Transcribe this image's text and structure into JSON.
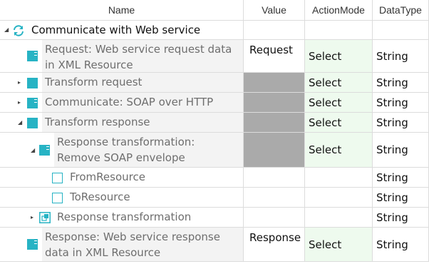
{
  "columns": {
    "name": "Name",
    "value": "Value",
    "action_mode": "ActionMode",
    "data_type": "DataType"
  },
  "root": {
    "label": "Communicate with Web service"
  },
  "rows": [
    {
      "name": "Request: Web service request data in XML Resource",
      "value": "Request",
      "action_mode": "Select",
      "data_type": "String"
    },
    {
      "name": "Transform request",
      "value": "",
      "action_mode": "Select",
      "data_type": "String"
    },
    {
      "name": "Communicate: SOAP over HTTP",
      "value": "",
      "action_mode": "Select",
      "data_type": "String"
    },
    {
      "name": "Transform response",
      "value": "",
      "action_mode": "Select",
      "data_type": "String"
    },
    {
      "name": "Response transformation: Remove SOAP envelope",
      "value": "",
      "action_mode": "Select",
      "data_type": "String"
    },
    {
      "name": "FromResource",
      "value": "",
      "action_mode": "",
      "data_type": "String"
    },
    {
      "name": "ToResource",
      "value": "",
      "action_mode": "",
      "data_type": "String"
    },
    {
      "name": "Response transformation",
      "value": "",
      "action_mode": "",
      "data_type": "String"
    },
    {
      "name": "Response: Web service response data in XML Resource",
      "value": "Response",
      "action_mode": "Select",
      "data_type": "String"
    }
  ],
  "icons": {
    "refresh": "refresh-icon",
    "module": "module-icon",
    "attribute": "attribute-icon",
    "reused_module": "reused-module-icon"
  },
  "colors": {
    "accent": "#27b3c4",
    "disabled_value": "#aaaaaa",
    "action_mode_bg": "#eefaee",
    "name_bg": "#f3f3f3"
  }
}
